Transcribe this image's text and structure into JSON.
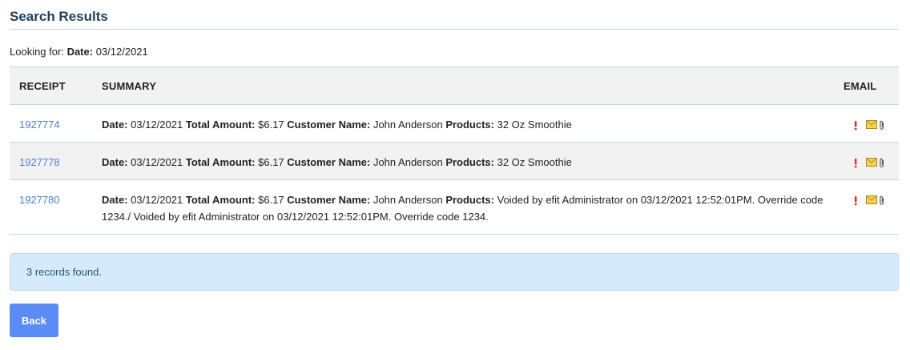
{
  "page": {
    "title": "Search Results"
  },
  "filter": {
    "prefix": "Looking for:",
    "label": "Date:",
    "value": "03/12/2021"
  },
  "table": {
    "headers": {
      "receipt": "RECEIPT",
      "summary": "SUMMARY",
      "email": "EMAIL"
    },
    "field_labels": {
      "date": "Date:",
      "total": "Total Amount:",
      "customer": "Customer Name:",
      "products": "Products:"
    },
    "rows": [
      {
        "receipt": "1927774",
        "date": "03/12/2021",
        "total": "$6.17",
        "customer": "John Anderson",
        "products": "32 Oz Smoothie"
      },
      {
        "receipt": "1927778",
        "date": "03/12/2021",
        "total": "$6.17",
        "customer": "John Anderson",
        "products": "32 Oz Smoothie"
      },
      {
        "receipt": "1927780",
        "date": "03/12/2021",
        "total": "$6.17",
        "customer": "John Anderson",
        "products": "Voided by efit Administrator on 03/12/2021 12:52:01PM. Override code 1234./ Voided by efit Administrator on 03/12/2021 12:52:01PM. Override code 1234."
      }
    ],
    "row_icons": [
      "exclamation-icon",
      "envelope-icon",
      "paperclip-icon"
    ]
  },
  "status": {
    "message": "3 records found."
  },
  "actions": {
    "back_label": "Back"
  },
  "colors": {
    "title": "#1d3f5e",
    "link": "#4b7fd6",
    "alert_bg": "#d5ebfb",
    "button": "#5b8cf5"
  }
}
